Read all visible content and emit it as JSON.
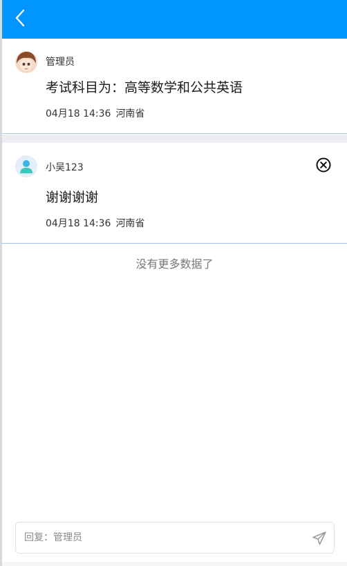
{
  "header": {
    "back_icon": "chevron-left-icon",
    "background": "#0095ff"
  },
  "comments": [
    {
      "author": "管理员",
      "text": "考试科目为：高等数学和公共英语",
      "time": "04月18 14:36",
      "location": "河南省",
      "avatar": "cartoon-girl-avatar"
    },
    {
      "author": "小吴123",
      "text": "谢谢谢谢",
      "time": "04月18 14:36",
      "location": "河南省",
      "avatar": "default-user-avatar",
      "delete_icon": "close-circle-icon"
    }
  ],
  "list_footer": "没有更多数据了",
  "reply": {
    "placeholder": "回复：管理员",
    "send_icon": "send-icon"
  }
}
